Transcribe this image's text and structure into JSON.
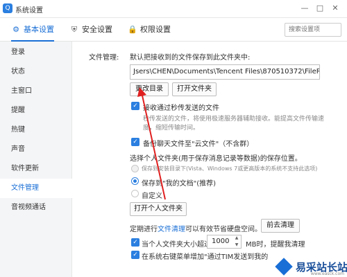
{
  "window": {
    "title": "系统设置",
    "icon": "qq-app-icon",
    "controls": [
      "minimize",
      "maximize",
      "close"
    ]
  },
  "tabs": [
    {
      "label": "基本设置",
      "icon": "gear-icon",
      "active": true
    },
    {
      "label": "安全设置",
      "icon": "shield-icon",
      "active": false
    },
    {
      "label": "权限设置",
      "icon": "lock-icon",
      "active": false
    }
  ],
  "search": {
    "placeholder": "搜索设置项"
  },
  "sidebar": {
    "items": [
      {
        "label": "登录"
      },
      {
        "label": "状态"
      },
      {
        "label": "主窗口"
      },
      {
        "label": "提醒"
      },
      {
        "label": "热键"
      },
      {
        "label": "声音"
      },
      {
        "label": "软件更新"
      },
      {
        "label": "文件管理",
        "active": true
      },
      {
        "label": "音视频通话"
      }
    ]
  },
  "file_mgmt": {
    "section_label": "文件管理:",
    "default_folder_text": "默认把接收到的文件保存到此文件夹中:",
    "path": "Jsers\\CHEN\\Documents\\Tencent Files\\870510372\\FileRecv\\",
    "change_dir_button": "更改目录",
    "open_folder_button": "打开文件夹",
    "instant_transfer": {
      "checked": true,
      "label": "接收通过秒传发送的文件",
      "desc_line1": "秒传发送的文件，将使用极速服务器辅助接收。能提高文件传输速",
      "desc_line2": "度，缩短传输时间。"
    },
    "backup": {
      "checked": true,
      "label": "备份聊天文件至\"云文件\"（不含群）"
    },
    "personal_folder_title": "选择个人文件夹(用于保存消息记录等数据)的保存位置。",
    "options": [
      {
        "label": "保存到安装目录下(Vista、Windows 7或更高版本的系统不支持此选项)",
        "state": "disabled"
      },
      {
        "label": "保存到\"我的文档\"(推荐)",
        "state": "selected"
      },
      {
        "label": "自定义",
        "state": "unselected"
      }
    ],
    "open_personal_folder_button": "打开个人文件夹",
    "cleanup": {
      "prefix": "定期进行",
      "link": "文件清理",
      "suffix": "可以有效节省硬盘空间。",
      "button": "前去清理"
    },
    "size_limit": {
      "checked": true,
      "prefix": "当个人文件夹大小超过",
      "value": "1000",
      "suffix": "MB时，提醒我清理"
    },
    "context_menu": {
      "checked": true,
      "label": "在系统右键菜单增加\"通过TIM发送到我的"
    }
  },
  "watermark": {
    "text": "易采站长站",
    "sub": "www.easck.com"
  }
}
